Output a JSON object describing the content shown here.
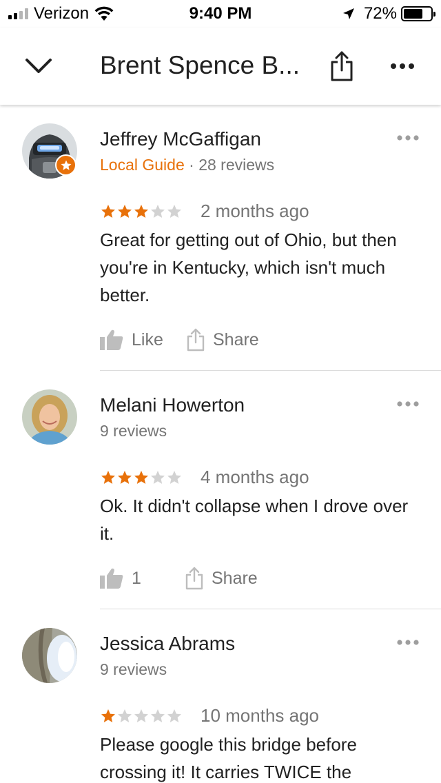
{
  "status_bar": {
    "carrier": "Verizon",
    "time": "9:40 PM",
    "battery_percent": "72%",
    "battery_level": 0.72,
    "signal_bars_filled": 2,
    "signal_bars_total": 4
  },
  "header": {
    "title": "Brent Spence B...",
    "back_icon": "chevron-down-icon",
    "share_icon": "share-icon",
    "more_icon": "more-horizontal-icon"
  },
  "colors": {
    "accent": "#e8710a",
    "star_filled": "#e8710a",
    "star_empty": "#d2d2d2",
    "secondary_text": "#757575"
  },
  "reviews": [
    {
      "name": "Jeffrey McGaffigan",
      "local_guide": "Local Guide",
      "separator": "·",
      "review_count": "28 reviews",
      "rating": 3,
      "max_rating": 5,
      "date": "2 months ago",
      "text": "Great for getting out of Ohio, but then you're in Kentucky, which isn't much better.",
      "like_label": "Like",
      "share_label": "Share"
    },
    {
      "name": "Melani Howerton",
      "review_count": "9 reviews",
      "rating": 3,
      "max_rating": 5,
      "date": "4 months ago",
      "text": "Ok. It didn't collapse when I drove over it.",
      "like_label": "1",
      "share_label": "Share"
    },
    {
      "name": "Jessica Abrams",
      "review_count": "9 reviews",
      "rating": 1,
      "max_rating": 5,
      "date": "10 months ago",
      "text": "Please google this bridge before crossing it! It carries TWICE the"
    }
  ]
}
